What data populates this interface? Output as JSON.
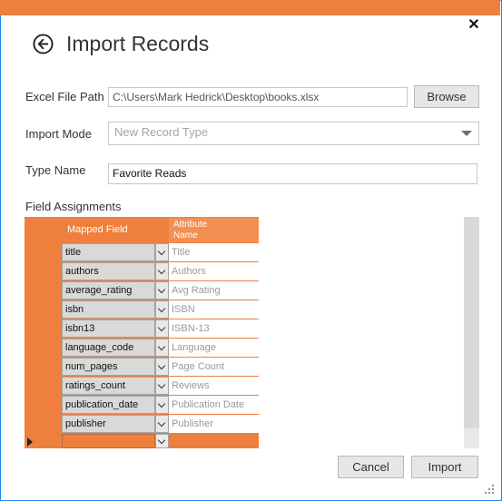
{
  "window": {
    "title": "Import Records",
    "accent": "#ef7f3c",
    "border": "#1e88e5"
  },
  "form": {
    "excel_label": "Excel File Path",
    "excel_value": "C:\\Users\\Mark Hedrick\\Desktop\\books.xlsx",
    "browse_label": "Browse",
    "mode_label": "Import Mode",
    "mode_value": "New Record Type",
    "type_label": "Type Name",
    "type_value": "Favorite Reads",
    "field_assignments_label": "Field Assignments"
  },
  "grid": {
    "headers": {
      "mapped": "Mapped Field",
      "attribute": "Attribute\nName"
    },
    "rows": [
      {
        "mapped": "title",
        "attribute": "Title"
      },
      {
        "mapped": "authors",
        "attribute": "Authors"
      },
      {
        "mapped": "average_rating",
        "attribute": "Avg Rating"
      },
      {
        "mapped": "isbn",
        "attribute": "ISBN"
      },
      {
        "mapped": "isbn13",
        "attribute": "ISBN-13"
      },
      {
        "mapped": "language_code",
        "attribute": "Language"
      },
      {
        "mapped": "  num_pages",
        "attribute": "Page Count"
      },
      {
        "mapped": "ratings_count",
        "attribute": "Reviews"
      },
      {
        "mapped": "publication_date",
        "attribute": "Publication Date"
      },
      {
        "mapped": "publisher",
        "attribute": "Publisher"
      }
    ]
  },
  "footer": {
    "cancel_label": "Cancel",
    "import_label": "Import"
  },
  "icons": {
    "back": "back-arrow-icon",
    "close": "close-icon",
    "dropdown": "chevron-down-icon",
    "row_indicator": "row-indicator-icon"
  }
}
